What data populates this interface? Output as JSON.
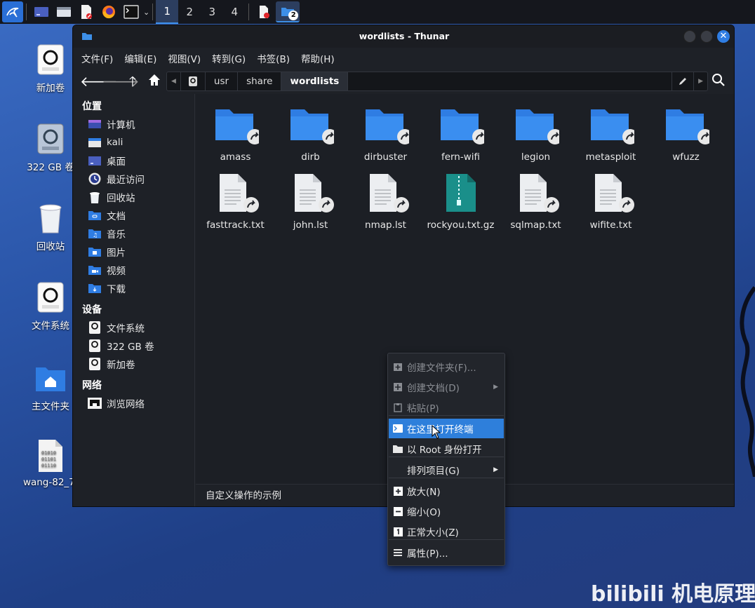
{
  "panel": {
    "workspaces": [
      "1",
      "2",
      "3",
      "4"
    ],
    "thunar_badge": "2"
  },
  "desktop": {
    "icons": [
      {
        "label": "新加卷",
        "icon": "drive-icon"
      },
      {
        "label": "322 GB 卷",
        "icon": "drive-icon"
      },
      {
        "label": "回收站",
        "icon": "trash-icon"
      },
      {
        "label": "文件系统",
        "icon": "drive-icon"
      },
      {
        "label": "主文件夹",
        "icon": "home-folder-icon"
      },
      {
        "label": "wang-82_7.",
        "icon": "binary-file-icon"
      }
    ]
  },
  "window": {
    "title": "wordlists - Thunar",
    "menu": [
      "文件(F)",
      "编辑(E)",
      "视图(V)",
      "转到(G)",
      "书签(B)",
      "帮助(H)"
    ],
    "path": [
      "usr",
      "share",
      "wordlists"
    ],
    "sidebar": {
      "places_header": "位置",
      "places": [
        {
          "label": "计算机",
          "icon": "computer-icon"
        },
        {
          "label": "kali",
          "icon": "home-icon"
        },
        {
          "label": "桌面",
          "icon": "desktop-icon"
        },
        {
          "label": "最近访问",
          "icon": "recent-icon"
        },
        {
          "label": "回收站",
          "icon": "trash-icon"
        },
        {
          "label": "文档",
          "icon": "documents-folder-icon"
        },
        {
          "label": "音乐",
          "icon": "music-folder-icon"
        },
        {
          "label": "图片",
          "icon": "pictures-folder-icon"
        },
        {
          "label": "视频",
          "icon": "videos-folder-icon"
        },
        {
          "label": "下载",
          "icon": "downloads-folder-icon"
        }
      ],
      "devices_header": "设备",
      "devices": [
        {
          "label": "文件系统",
          "icon": "drive-icon"
        },
        {
          "label": "322 GB 卷",
          "icon": "drive-icon"
        },
        {
          "label": "新加卷",
          "icon": "drive-icon"
        }
      ],
      "network_header": "网络",
      "network": [
        {
          "label": "浏览网络",
          "icon": "network-icon"
        }
      ]
    },
    "files": [
      {
        "name": "amass",
        "type": "folder-link"
      },
      {
        "name": "dirb",
        "type": "folder-link"
      },
      {
        "name": "dirbuster",
        "type": "folder-link"
      },
      {
        "name": "fern-wifi",
        "type": "folder-link"
      },
      {
        "name": "legion",
        "type": "folder-link"
      },
      {
        "name": "metasploit",
        "type": "folder-link"
      },
      {
        "name": "wfuzz",
        "type": "folder-link"
      },
      {
        "name": "fasttrack.txt",
        "type": "text-link"
      },
      {
        "name": "john.lst",
        "type": "text-link"
      },
      {
        "name": "nmap.lst",
        "type": "text-link"
      },
      {
        "name": "rockyou.txt.gz",
        "type": "archive"
      },
      {
        "name": "sqlmap.txt",
        "type": "text-link"
      },
      {
        "name": "wifite.txt",
        "type": "text-link"
      }
    ],
    "status": "自定义操作的示例"
  },
  "context_menu": {
    "items": [
      {
        "label": "创建文件夹(F)...",
        "icon": "new-folder-icon",
        "disabled": true
      },
      {
        "label": "创建文档(D)",
        "icon": "new-document-icon",
        "disabled": true,
        "submenu": true
      },
      {
        "label": "粘贴(P)",
        "icon": "paste-icon",
        "disabled": true
      },
      {
        "label": "在这里打开终端",
        "icon": "terminal-icon",
        "highlighted": true
      },
      {
        "label": "以 Root 身份打开",
        "icon": "folder-icon"
      },
      {
        "label": "排列项目(G)",
        "icon": "",
        "submenu": true
      },
      {
        "label": "放大(N)",
        "icon": "zoom-in-icon"
      },
      {
        "label": "缩小(O)",
        "icon": "zoom-out-icon"
      },
      {
        "label": "正常大小(Z)",
        "icon": "zoom-reset-icon"
      },
      {
        "label": "属性(P)...",
        "icon": "properties-icon"
      }
    ]
  },
  "watermark": "bilibili 机电原理",
  "colors": {
    "accent": "#2e7fdb",
    "folder": "#2f7de3",
    "archive": "#1a8f8a"
  }
}
